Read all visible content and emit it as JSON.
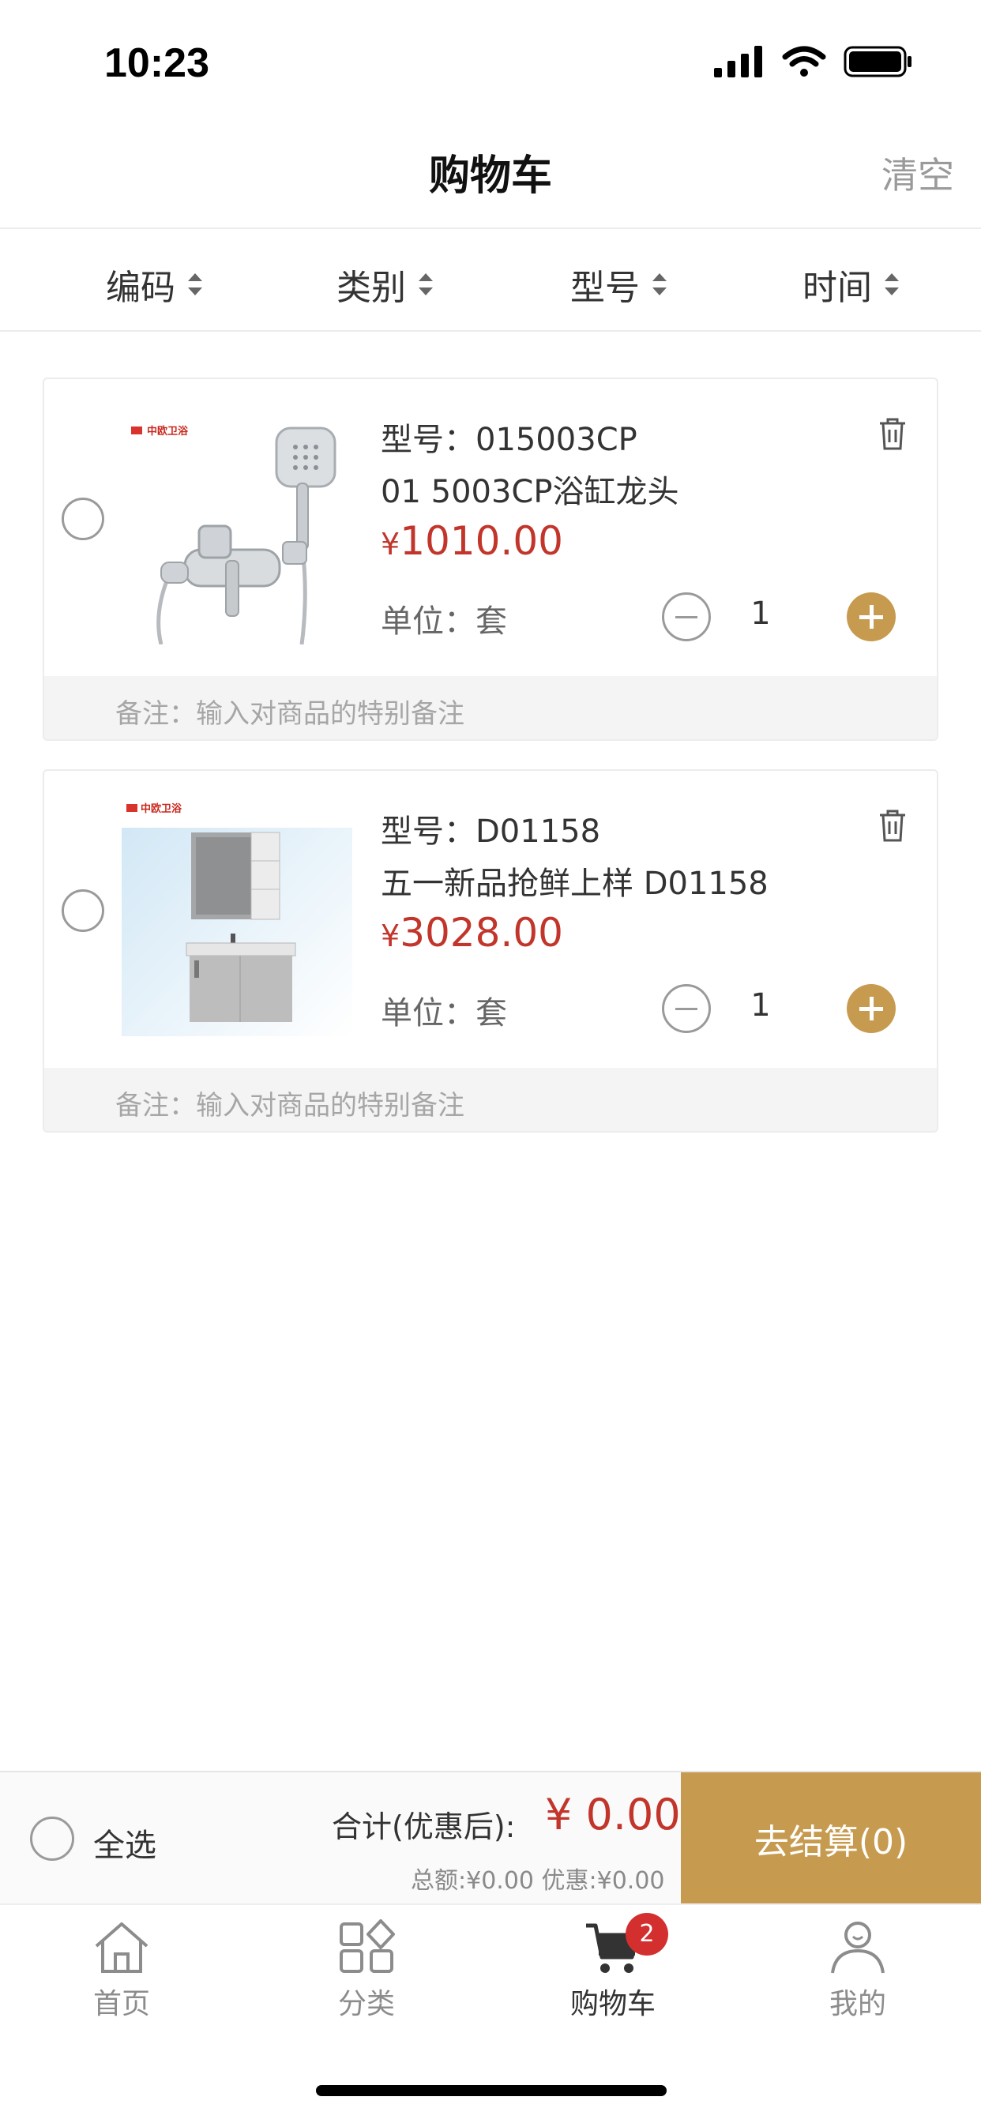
{
  "status_bar": {
    "time": "10:23"
  },
  "header": {
    "title": "购物车",
    "clear_label": "清空"
  },
  "sort_bar": {
    "items": [
      {
        "label": "编码"
      },
      {
        "label": "类别"
      },
      {
        "label": "型号"
      },
      {
        "label": "时间"
      }
    ]
  },
  "cart": {
    "items": [
      {
        "model": "型号：015003CP",
        "name": "01 5003CP浴缸龙头",
        "currency": "¥",
        "price": "1010.00",
        "unit": "单位：套",
        "quantity": "1",
        "remark_placeholder": "备注：输入对商品的特别备注"
      },
      {
        "model": "型号：D01158",
        "name": "五一新品抢鲜上样 D01158",
        "currency": "¥",
        "price": "3028.00",
        "unit": "单位：套",
        "quantity": "1",
        "remark_placeholder": "备注：输入对商品的特别备注"
      }
    ]
  },
  "checkout": {
    "select_all_label": "全选",
    "total_label": "合计(优惠后):",
    "total_value": "¥ 0.00",
    "total_detail": "总额:¥0.00 优惠:¥0.00",
    "button_label": "去结算(0)"
  },
  "tab_bar": {
    "cart_badge": "2",
    "tabs": [
      {
        "label": "首页",
        "icon": "home-icon"
      },
      {
        "label": "分类",
        "icon": "category-icon"
      },
      {
        "label": "购物车",
        "icon": "cart-icon"
      },
      {
        "label": "我的",
        "icon": "profile-icon"
      }
    ]
  },
  "colors": {
    "accent": "#c79b4f",
    "price": "#c2352b",
    "badge": "#d32f2f"
  }
}
